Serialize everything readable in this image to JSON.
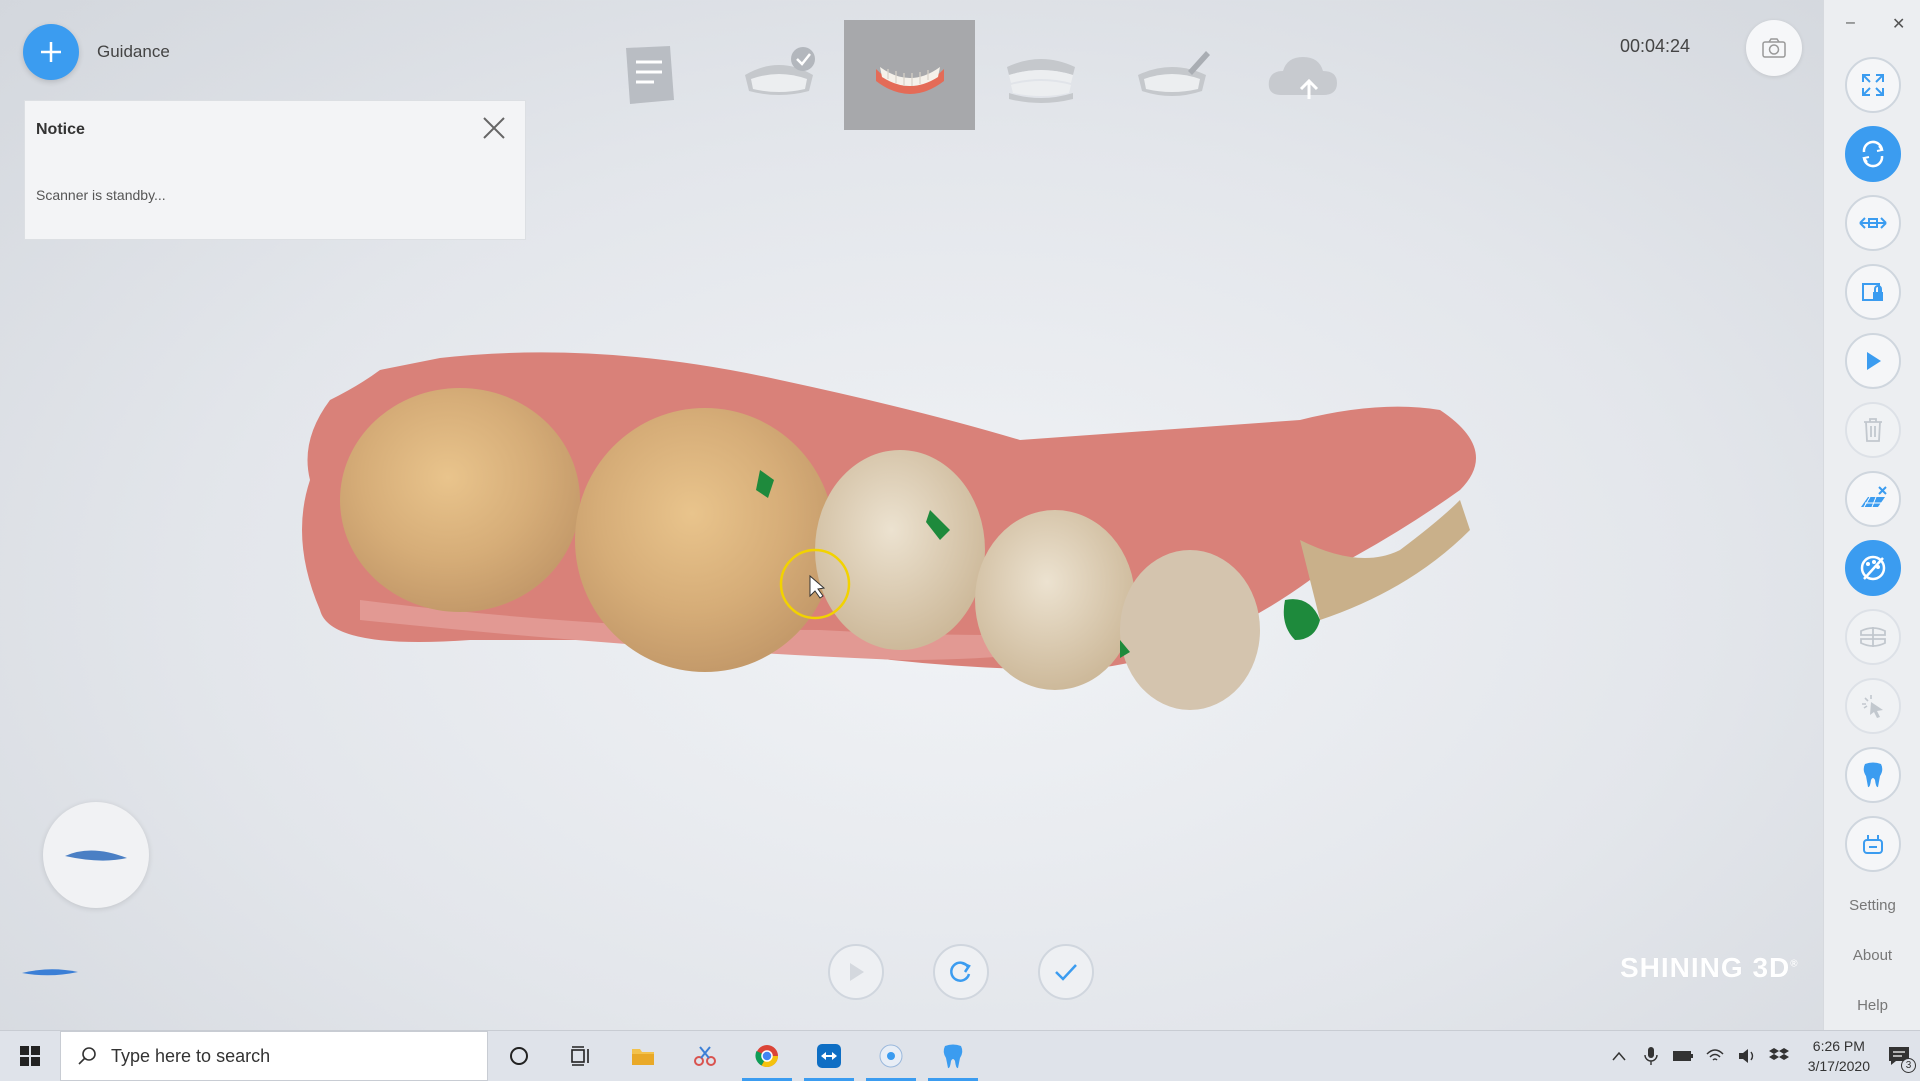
{
  "app": {
    "guidance_label": "Guidance",
    "timer": "00:04:24",
    "brand": "SHINING 3D",
    "brand_mark": "®"
  },
  "notice": {
    "title": "Notice",
    "message": "Scanner is standby..."
  },
  "steps": [
    {
      "icon": "order-form-icon"
    },
    {
      "icon": "upper-jaw-done-icon"
    },
    {
      "icon": "lower-jaw-icon",
      "active": true
    },
    {
      "icon": "both-jaws-icon"
    },
    {
      "icon": "edit-jaw-icon"
    },
    {
      "icon": "upload-cloud-icon"
    }
  ],
  "right_panel": {
    "setting": "Setting",
    "about": "About",
    "help": "Help",
    "minimize": "–",
    "close": "✕"
  },
  "taskbar": {
    "search_placeholder": "Type here to search",
    "time": "6:26 PM",
    "date": "3/17/2020",
    "notif_count": "3"
  },
  "colors": {
    "accent": "#3b9cf0",
    "gum": "#d9827a",
    "tooth": "#d9b27c",
    "hole": "#1e8a3c"
  }
}
